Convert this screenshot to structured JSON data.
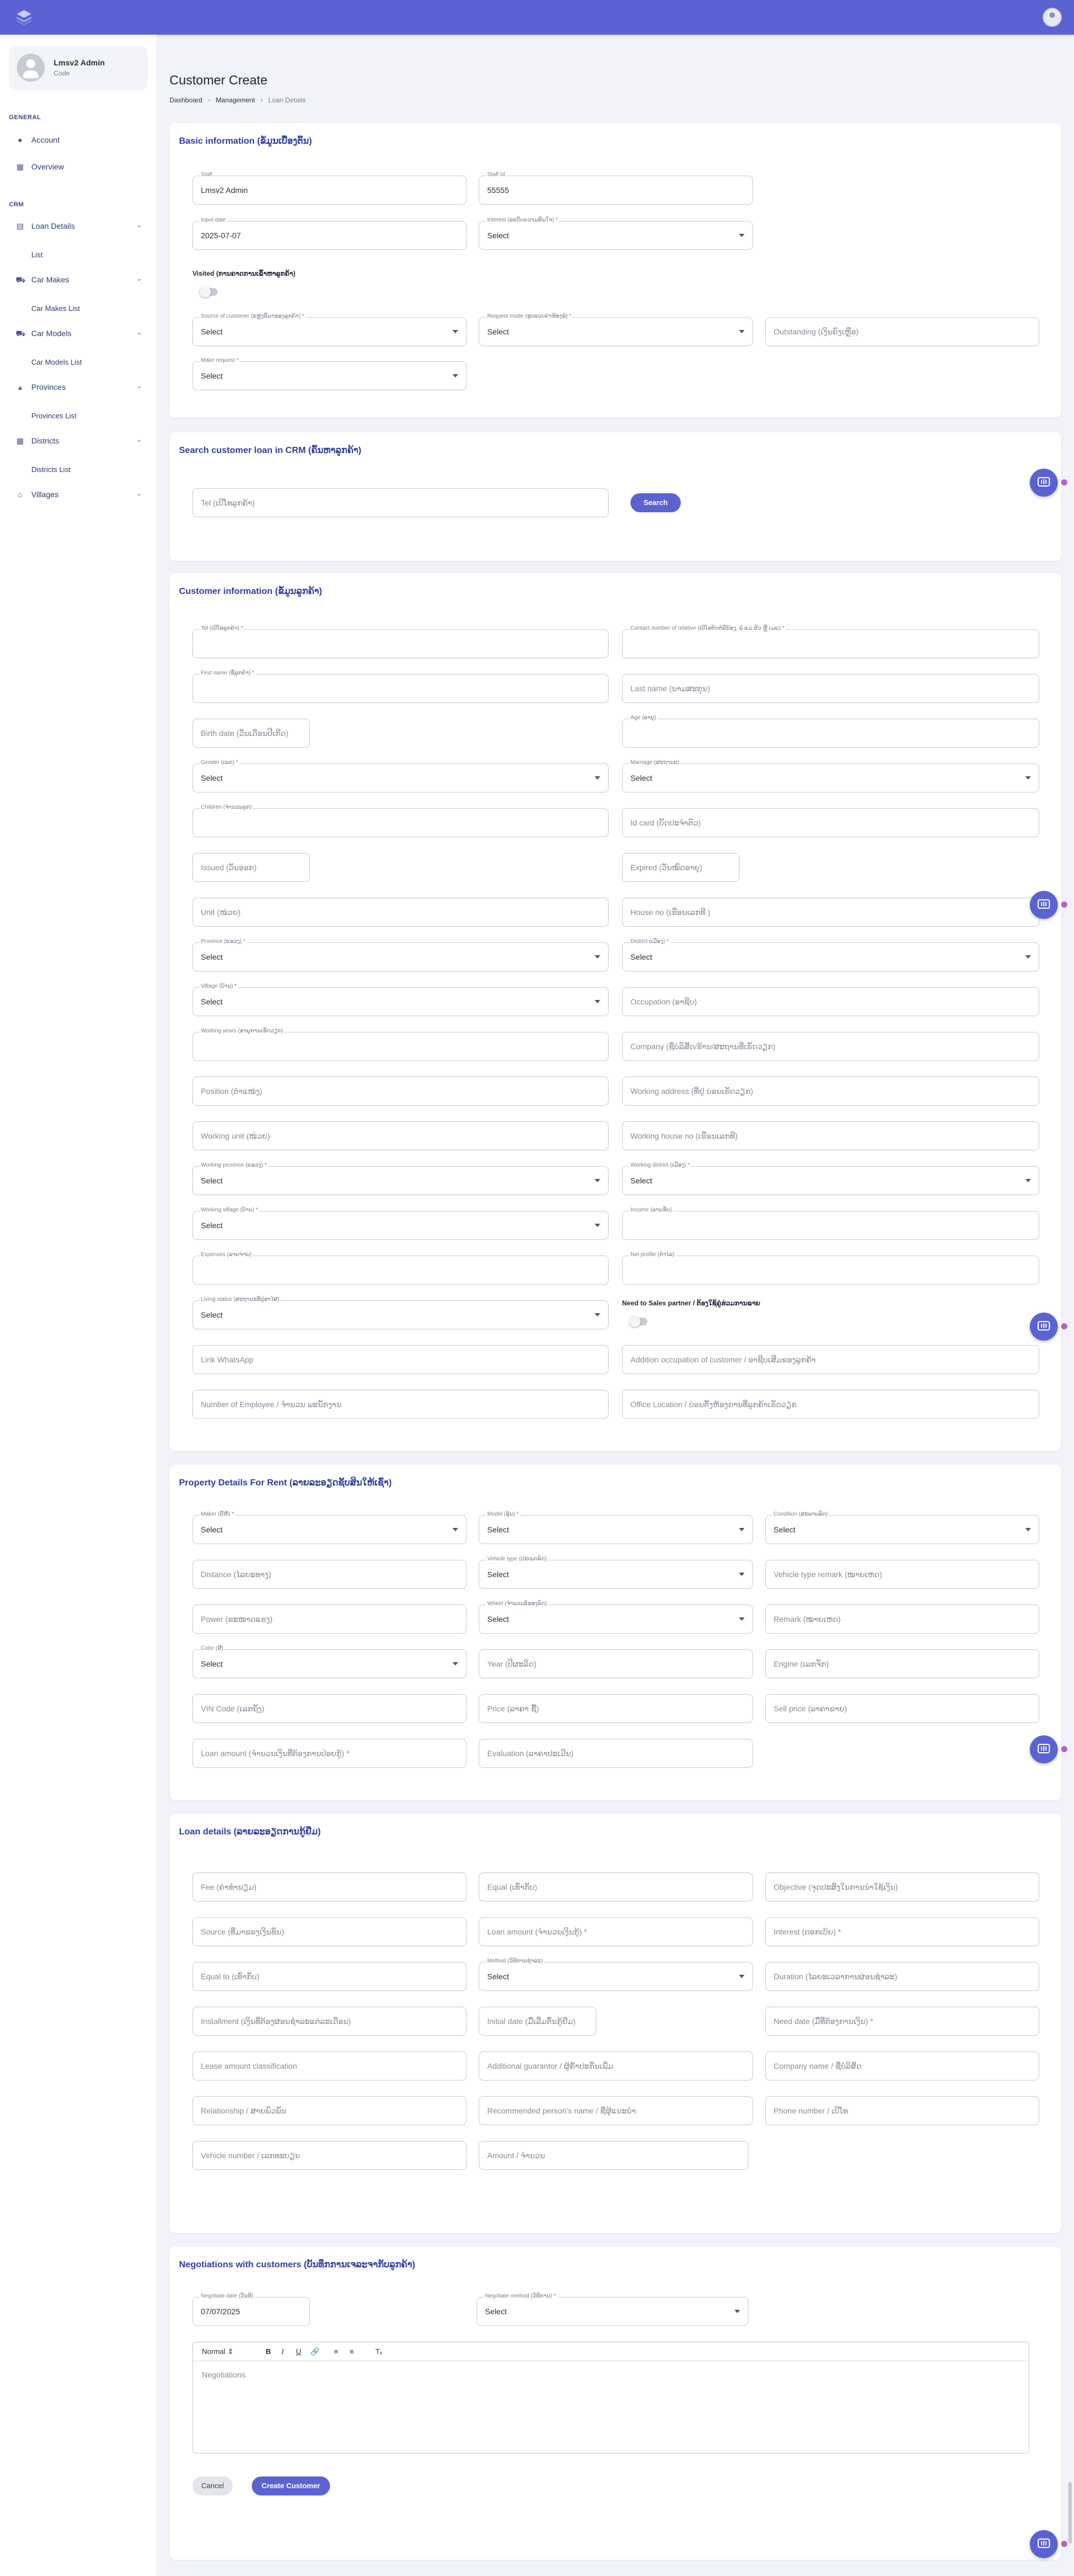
{
  "sidebar": {
    "user_name": "Lmsv2 Admin",
    "user_role": "Code",
    "section_general": "GENERAL",
    "account": "Account",
    "overview": "Overview",
    "section_crm": "CRM",
    "loan_details": "Loan Details",
    "list": "List",
    "car_makes": "Car Makes",
    "car_makes_list": "Car Makes List",
    "car_models": "Car Models",
    "car_models_list": "Car Models List",
    "provinces": "Provinces",
    "provinces_list": "Provinces List",
    "districts": "Districts",
    "districts_list": "Districts List",
    "villages": "Villages"
  },
  "page": {
    "title": "Customer Create",
    "bc_dashboard": "Dashboard",
    "bc_management": "Management",
    "bc_current": "Loan Details"
  },
  "basic": {
    "title": "Basic information (ຂໍ້ມູນເບື້ອງຕົ້ນ)",
    "staff_label": "Staff",
    "staff_value": "Lmsv2 Admin",
    "staff_id_label": "Staff Id",
    "staff_id_value": "55555",
    "input_date_label": "Input date",
    "input_date_value": "2025-07-07",
    "interest_label": "Interest (ລະດັບຄວາມສົນໃຈ) *",
    "visited_label": "Visited (ການຄາດການເຂົ້າຫາລູກຄ້າ)",
    "source_label": "Source of customer (ແຫຼ່ງທີ່ມາຂອງລູກຄ້າ) *",
    "request_mode_label": "Request mode (ຮູບແບບຄຳຮ້ອງຂໍ) *",
    "outstanding_ph": "Outstanding (ເງິນຄົງເຫຼືອ)",
    "make_request_label": "Make request *",
    "select": "Select"
  },
  "search": {
    "title": "Search customer loan in CRM (ຄົ້ນຫາລູກຄ້າ)",
    "tel_ph": "Tel (ເບີໂທລູກຄ້າ)",
    "button": "Search"
  },
  "customer": {
    "title": "Customer information (ຂໍ້ມູນລູກຄ້າ)",
    "tel_label": "Tel (ເບີໂທລູກຄ້າ) *",
    "contact_label": "Contact number of relative (ເບີໂທຕິດຕໍ່ພີ່ນ້ອງ, ພໍ່ ແມ່ ຜົວ ຫຼື ເມຍ) *",
    "first_name_label": "First name (ຊື່ລູກຄ້າ) *",
    "last_name_ph": "Last name (ນາມສະກຸນ)",
    "birth_ph": "Birth date (ວັນເດືອນປີເກີດ)",
    "age_label": "Age (ອາຍຸ)",
    "gender_label": "Gender (ເພດ) *",
    "marriage_label": "Marriage (ສະຖານະ)",
    "children_label": "Children (ຈຳນວນລູກ)",
    "id_card_ph": "Id card (ບັດປະຈຳຕົວ)",
    "issued_ph": "Issued (ວັນອອກ)",
    "expired_ph": "Expired (ວັນໝົດອາຍຸ)",
    "unit_ph": "Unit (ໜ່ວຍ)",
    "house_no_ph": "House no (ເຮືອນເລກທີ )",
    "province_label": "Province (ແຂວງ) *",
    "district_label": "District (ເມືອງ) *",
    "village_label": "Village (ບ້ານ) *",
    "occupation_ph": "Occupation (ອາຊີບ)",
    "working_years_label": "Working years (ອາຍຸການເຮັດວຽກ)",
    "company_ph": "Company (ຊື່ບໍລິສັດ/ຮ້ານ/ສະຖານທີ່ເຮັດວຽກ)",
    "position_ph": "Position (ຕຳແໜ່ງ)",
    "working_address_ph": "Working address (ທີ່ຢູ່ ບ່ອນເຮັດວຽກ)",
    "working_unit_ph": "Working unit (ໜ່ວຍ)",
    "working_house_ph": "Working house no (ເຮືອນເລກທີ)",
    "working_province_label": "Working province (ແຂວງ) *",
    "working_district_label": "Working district (ເມືອງ) *",
    "working_village_label": "Working village (ບ້ານ) *",
    "income_label": "Income (ລາຍຮັບ)",
    "expenses_label": "Expenses (ລາຍຈ່າຍ)",
    "net_profile_label": "Net profile (ກຳໄລ)",
    "living_status_label": "Living status (ສະຖານະທີ່ຢູ່ອາໄສ)",
    "sales_partner_label": "Need to Sales partner / ຕ້ອງໃຊ້ຄູ່ຮ່ວມການຂາຍ",
    "whatsapp_ph": "Link WhatsApp",
    "addition_occupation_ph": "Addition occupation of customer / ອາຊີບເສີມຂອງລູກຄ້າ",
    "employee_ph": "Number of Employee / ຈຳນວນ ພະນັກງານ",
    "office_location_ph": "Office Location / ບ່ອນຕັ້ງຫ້ອງການທີ່ລູກຄ້າເຮັດວຽກ"
  },
  "property": {
    "title": "Property Details For Rent (ລາຍລະອຽດຊັບສິນໃຫ້ເຊົ່າ)",
    "maker_label": "Maker (ຍີ່ຫໍ້) *",
    "model_label": "Model (ລຸ້ນ) *",
    "condition_label": "Condition (ສະພາບລົດ)",
    "distance_ph": "Distance (ໄລຍະທາງ)",
    "vehicle_type_label": "Vehicle type (ປະເພດລົດ)",
    "vehicle_type_remark_ph": "Vehicle type remark (ໝາຍເຫດ)",
    "power_ph": "Power (ຂະໜາດແຮງ)",
    "wheel_label": "Wheel (ຈຳນວນລໍ້ຂອງລົດ)",
    "remark_ph": "Remark (ໝາຍເຫດ)",
    "color_label": "Color (ສີ)",
    "year_ph": "Year (ປີຜະລິດ)",
    "engine_ph": "Engine (ເລກຈັກ)",
    "vin_ph": "VIN Code (ເລກຖັງ)",
    "price_ph": "Price (ລາຄາ ຊື້)",
    "sell_price_ph": "Sell price (ລາຄາຂາຍ)",
    "loan_amount_ph": "Loan amount (ຈຳນວນເງິນທີ່ຕ້ອງການປ່ອຍກູ້) *",
    "evaluation_ph": "Evaluation (ລາຄາປະເມີນ)"
  },
  "loan": {
    "title": "Loan details (ລາຍລະອຽດການກູ້ຢືມ)",
    "fee_ph": "Fee (ຄ່າທຳນຽມ)",
    "equal_ph": "Equal (ເທົ່າກັບ)",
    "objective_ph": "Objective (ຈຸດປະສົງໃນການນຳໃຊ້ເງິນ)",
    "source_ph": "Source (ທີ່ມາຂອງເງິນທຶນ)",
    "loan_amount_ph": "Loan amount (ຈຳນວນເງິນກູ້) *",
    "interest_ph": "Interest (ດອກເບ້ຍ) *",
    "equal_to_ph": "Equal to (ເທົ່າກັບ)",
    "method_label": "Method (ວິທີການຊຳລະ)",
    "duration_ph": "Duration (ໄລຍະເວລາການຜ່ອນຊຳລະ)",
    "installment_ph": "Installment (ເງິນທີ່ຕ້ອງຜ່ອນຊຳລະແຕ່ລະເດືອນ)",
    "initial_date_ph": "Initial date (ມື້ເລີ່ມຕົ້ນກູ້ຢືມ)",
    "need_date_ph": "Need date (ມື້ທີ່ຕ້ອງການເງິນ) *",
    "lease_ph": "Lease amount classification",
    "guarantor_ph": "Additional guarantor / ຜູ້ຄ້ຳປະກັນເພີ່ມ",
    "company_name_ph": "Company name / ຊື່ບໍລິສັດ",
    "relationship_ph": "Relationship / ສາຍພົວພັນ",
    "recommended_ph": "Recommended person's name / ຊື່ຜູ້ແນະນຳ",
    "phone_ph": "Phone number / ເບີໂທ",
    "vehicle_number_ph": "Vehicle number / ເລກທະບຽນ",
    "amount_ph": "Amount / ຈຳນວນ"
  },
  "nego": {
    "title": "Negotiations with customers (ບັນທຶກການເຈລະຈາກັບລູກຄ້າ)",
    "date_label": "Negotiate date (ວັນທີ)",
    "date_value": "07/07/2025",
    "method_label": "Negotiate method (ວິທີການ) *",
    "editor_style": "Normal",
    "editor_ph": "Negotiations",
    "cancel": "Cancel",
    "create": "Create Customer"
  }
}
